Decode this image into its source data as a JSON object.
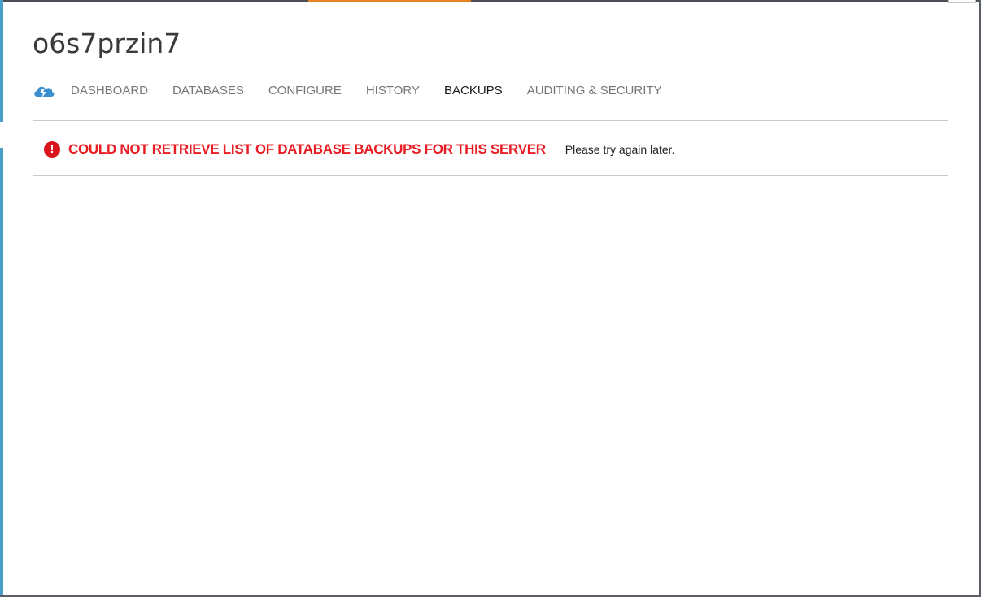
{
  "server": {
    "name": "o6s7przin7"
  },
  "nav": {
    "icon": "sql-database-cloud-icon",
    "tabs": [
      {
        "label": "DASHBOARD",
        "active": false
      },
      {
        "label": "DATABASES",
        "active": false
      },
      {
        "label": "CONFIGURE",
        "active": false
      },
      {
        "label": "HISTORY",
        "active": false
      },
      {
        "label": "BACKUPS",
        "active": true
      },
      {
        "label": "AUDITING & SECURITY",
        "active": false
      }
    ]
  },
  "error": {
    "icon": "error-exclamation-icon",
    "title": "COULD NOT RETRIEVE LIST OF DATABASE BACKUPS FOR THIS SERVER",
    "detail": "Please try again later."
  },
  "colors": {
    "accent_blue": "#4a9fc7",
    "accent_orange": "#e8811f",
    "error_red": "#e81c22",
    "tab_inactive": "#767676",
    "tab_active": "#1a1a1a"
  }
}
